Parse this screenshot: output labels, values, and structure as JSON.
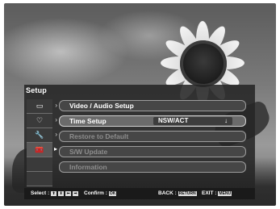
{
  "setup": {
    "title": "Setup",
    "tabs": [
      {
        "icon": "picture-icon",
        "glyph": "▭",
        "active": false
      },
      {
        "icon": "heart-icon",
        "glyph": "♡",
        "active": false
      },
      {
        "icon": "wrench-icon",
        "glyph": "🔧",
        "active": false
      },
      {
        "icon": "toolbox-icon",
        "glyph": "🧰",
        "active": true
      }
    ],
    "items": [
      {
        "label": "Video / Audio Setup",
        "state": "enabled"
      },
      {
        "label": "Time Setup",
        "state": "selected",
        "value": "NSW/ACT"
      },
      {
        "label": "Restore to Default",
        "state": "disabled"
      },
      {
        "label": "S/W Update",
        "state": "disabled"
      },
      {
        "label": "Information",
        "state": "disabled"
      }
    ]
  },
  "footer": {
    "select_label": "Select :",
    "select_keys": [
      "⬆",
      "⬇",
      "⬅",
      "➡"
    ],
    "confirm_label": "Confirm :",
    "confirm_key": "OK",
    "back_label": "BACK :",
    "back_key": "RETURN",
    "exit_label": "EXIT :",
    "exit_key": "MENU"
  }
}
